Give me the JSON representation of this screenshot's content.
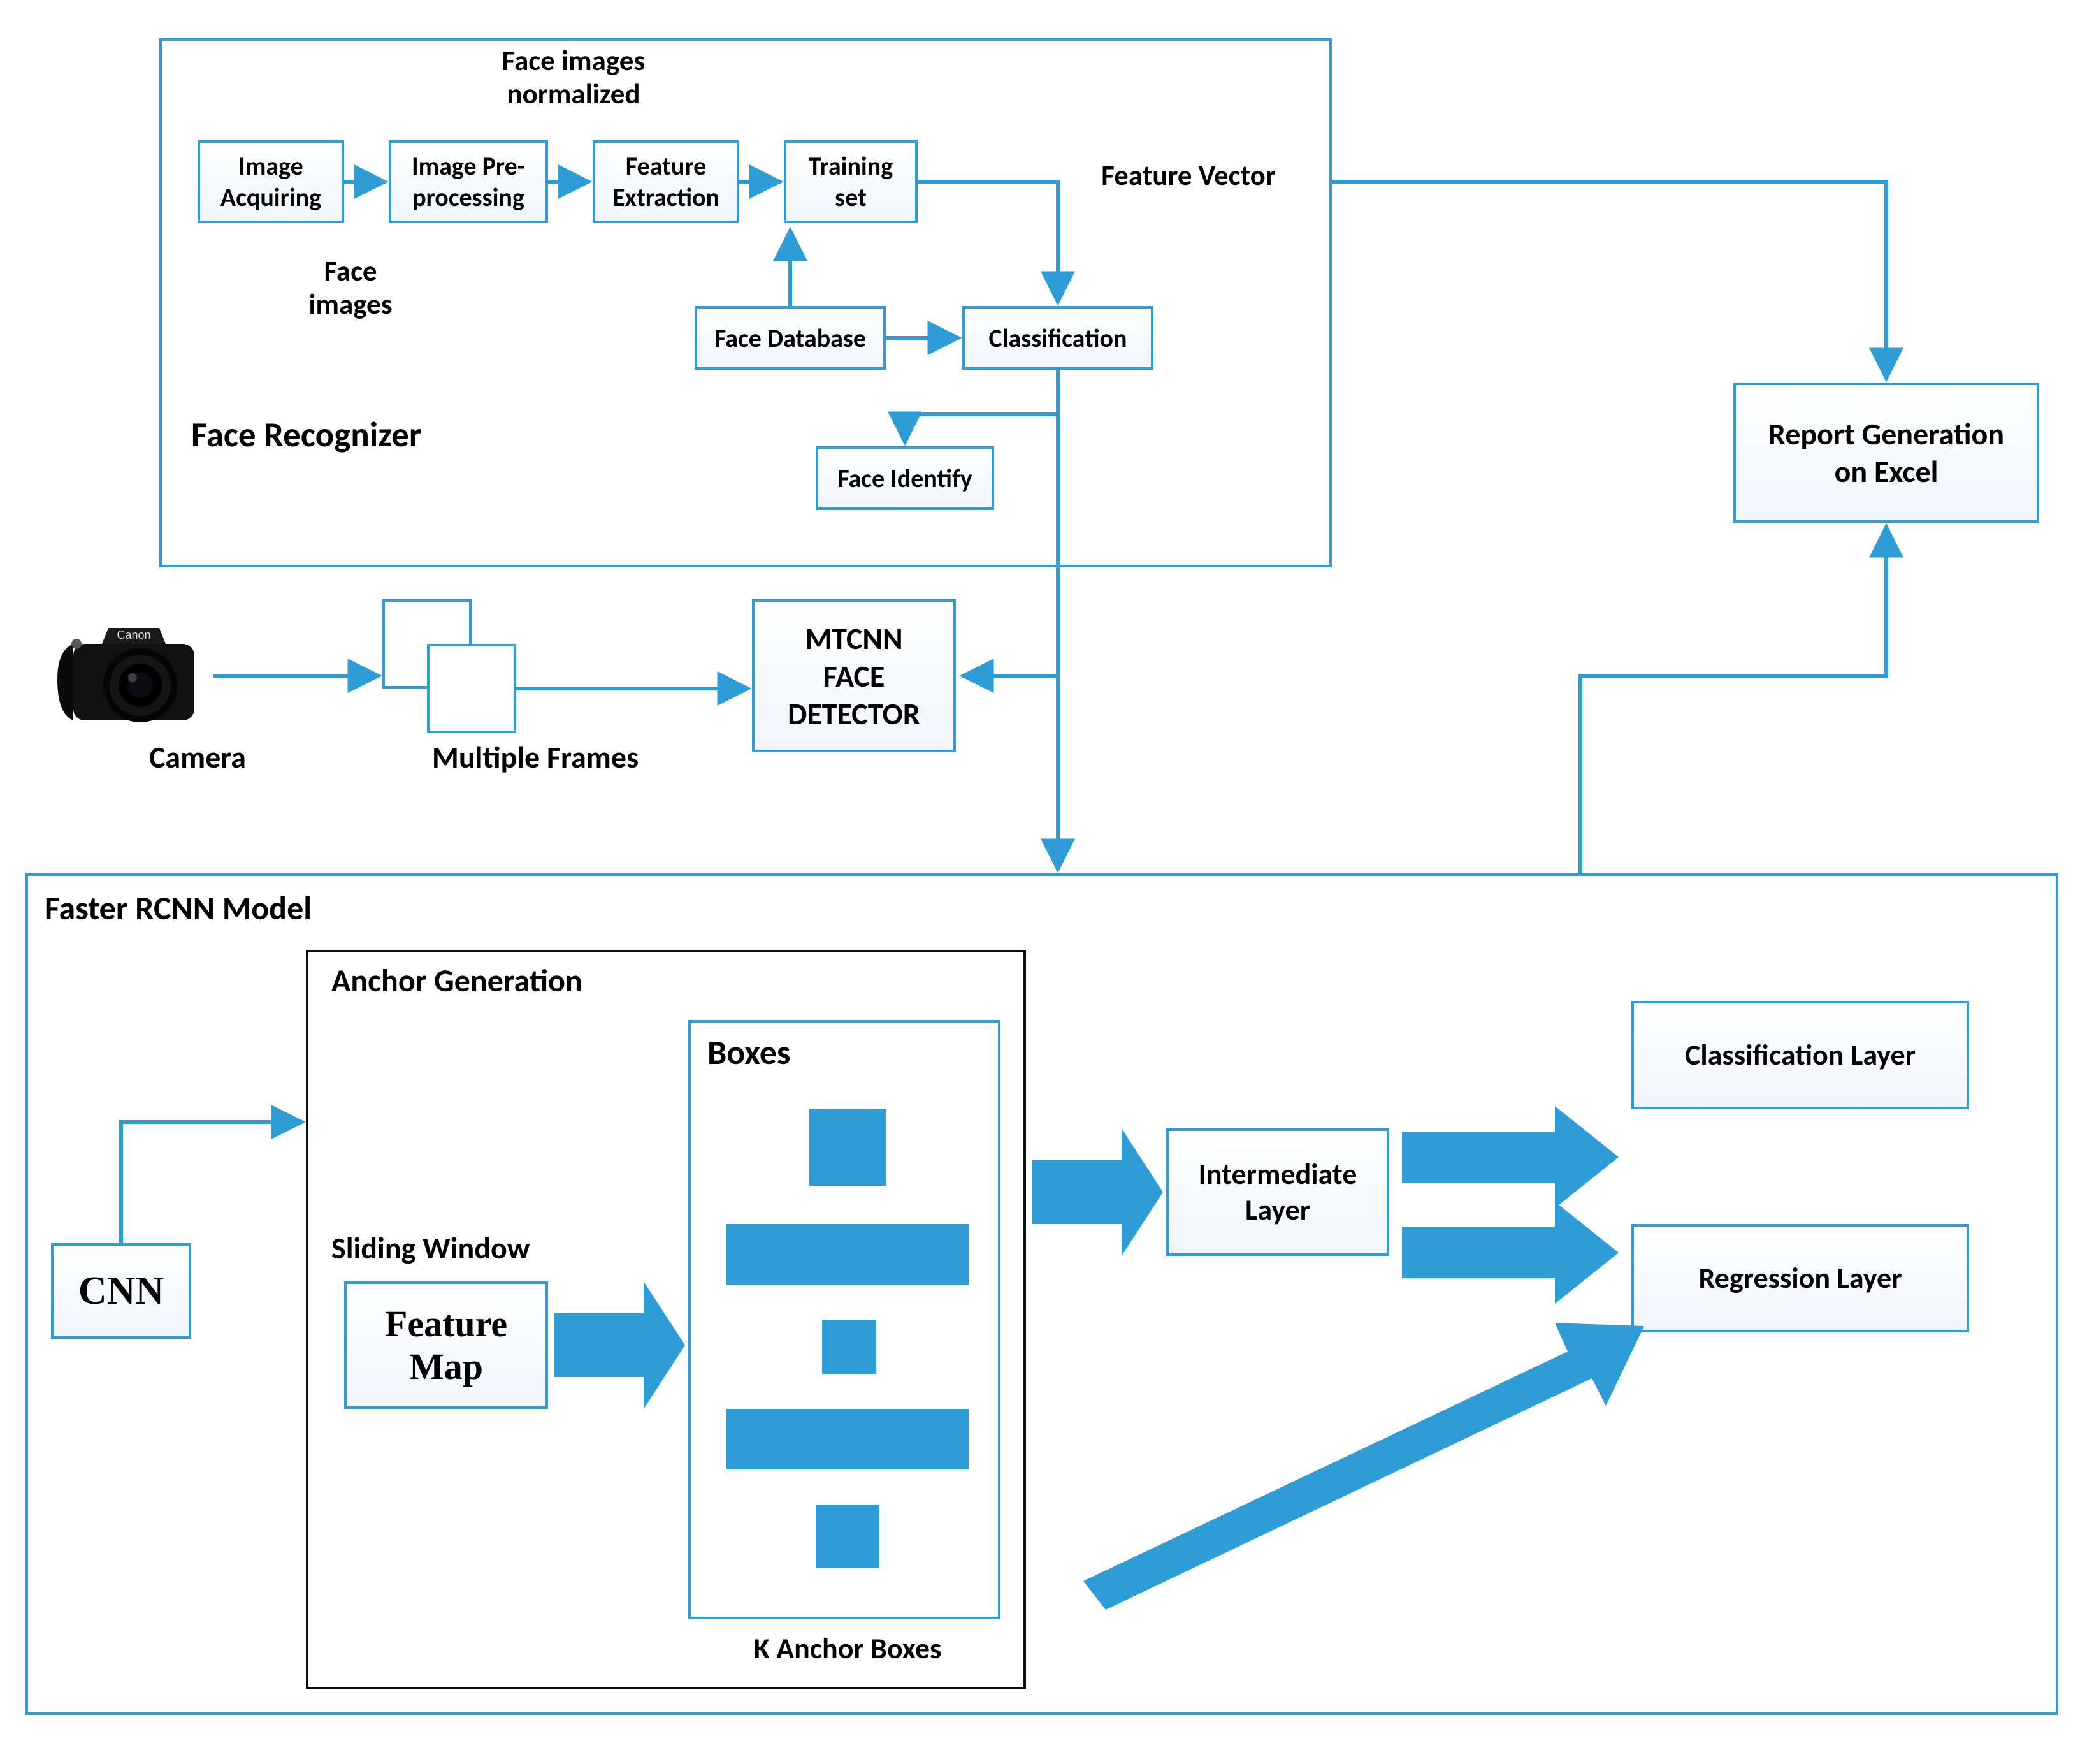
{
  "faceRecognizer": {
    "title": "Face Recognizer",
    "normalizedLabel": "Face images\nnormalized",
    "faceImagesLabel": "Face\nimages",
    "featureVectorLabel": "Feature Vector",
    "boxes": {
      "imageAcquiring": "Image\nAcquiring",
      "imagePreprocessing": "Image Pre-\nprocessing",
      "featureExtraction": "Feature\nExtraction",
      "trainingSet": "Training\nset",
      "faceDatabase": "Face Database",
      "classification": "Classification",
      "faceIdentify": "Face Identify"
    }
  },
  "cameraLabel": "Camera",
  "multipleFramesLabel": "Multiple Frames",
  "mtcnn": "MTCNN\nFACE\nDETECTOR",
  "report": "Report Generation\non Excel",
  "faster": {
    "title": "Faster RCNN Model",
    "cnn": "CNN",
    "anchorGen": "Anchor Generation",
    "slidingWindow": "Sliding Window",
    "featureMap": "Feature\nMap",
    "boxesTitle": "Boxes",
    "kAnchor": "K Anchor Boxes",
    "intermediate": "Intermediate\nLayer",
    "classificationLayer": "Classification Layer",
    "regressionLayer": "Regression Layer"
  }
}
